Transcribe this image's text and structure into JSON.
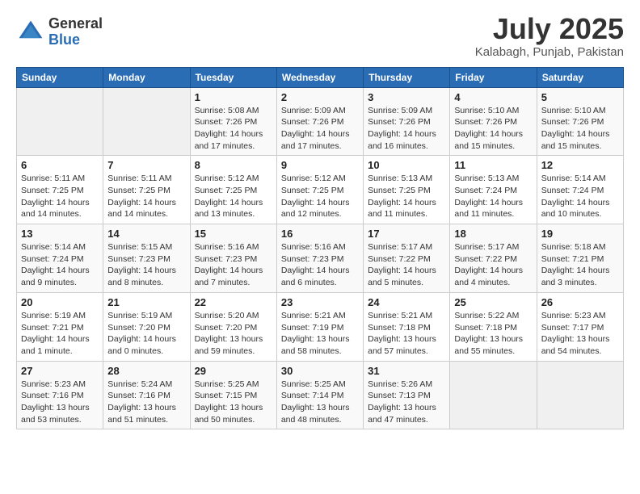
{
  "header": {
    "logo_general": "General",
    "logo_blue": "Blue",
    "month": "July 2025",
    "location": "Kalabagh, Punjab, Pakistan"
  },
  "weekdays": [
    "Sunday",
    "Monday",
    "Tuesday",
    "Wednesday",
    "Thursday",
    "Friday",
    "Saturday"
  ],
  "weeks": [
    [
      {
        "day": "",
        "info": ""
      },
      {
        "day": "",
        "info": ""
      },
      {
        "day": "1",
        "info": "Sunrise: 5:08 AM\nSunset: 7:26 PM\nDaylight: 14 hours and 17 minutes."
      },
      {
        "day": "2",
        "info": "Sunrise: 5:09 AM\nSunset: 7:26 PM\nDaylight: 14 hours and 17 minutes."
      },
      {
        "day": "3",
        "info": "Sunrise: 5:09 AM\nSunset: 7:26 PM\nDaylight: 14 hours and 16 minutes."
      },
      {
        "day": "4",
        "info": "Sunrise: 5:10 AM\nSunset: 7:26 PM\nDaylight: 14 hours and 15 minutes."
      },
      {
        "day": "5",
        "info": "Sunrise: 5:10 AM\nSunset: 7:26 PM\nDaylight: 14 hours and 15 minutes."
      }
    ],
    [
      {
        "day": "6",
        "info": "Sunrise: 5:11 AM\nSunset: 7:25 PM\nDaylight: 14 hours and 14 minutes."
      },
      {
        "day": "7",
        "info": "Sunrise: 5:11 AM\nSunset: 7:25 PM\nDaylight: 14 hours and 14 minutes."
      },
      {
        "day": "8",
        "info": "Sunrise: 5:12 AM\nSunset: 7:25 PM\nDaylight: 14 hours and 13 minutes."
      },
      {
        "day": "9",
        "info": "Sunrise: 5:12 AM\nSunset: 7:25 PM\nDaylight: 14 hours and 12 minutes."
      },
      {
        "day": "10",
        "info": "Sunrise: 5:13 AM\nSunset: 7:25 PM\nDaylight: 14 hours and 11 minutes."
      },
      {
        "day": "11",
        "info": "Sunrise: 5:13 AM\nSunset: 7:24 PM\nDaylight: 14 hours and 11 minutes."
      },
      {
        "day": "12",
        "info": "Sunrise: 5:14 AM\nSunset: 7:24 PM\nDaylight: 14 hours and 10 minutes."
      }
    ],
    [
      {
        "day": "13",
        "info": "Sunrise: 5:14 AM\nSunset: 7:24 PM\nDaylight: 14 hours and 9 minutes."
      },
      {
        "day": "14",
        "info": "Sunrise: 5:15 AM\nSunset: 7:23 PM\nDaylight: 14 hours and 8 minutes."
      },
      {
        "day": "15",
        "info": "Sunrise: 5:16 AM\nSunset: 7:23 PM\nDaylight: 14 hours and 7 minutes."
      },
      {
        "day": "16",
        "info": "Sunrise: 5:16 AM\nSunset: 7:23 PM\nDaylight: 14 hours and 6 minutes."
      },
      {
        "day": "17",
        "info": "Sunrise: 5:17 AM\nSunset: 7:22 PM\nDaylight: 14 hours and 5 minutes."
      },
      {
        "day": "18",
        "info": "Sunrise: 5:17 AM\nSunset: 7:22 PM\nDaylight: 14 hours and 4 minutes."
      },
      {
        "day": "19",
        "info": "Sunrise: 5:18 AM\nSunset: 7:21 PM\nDaylight: 14 hours and 3 minutes."
      }
    ],
    [
      {
        "day": "20",
        "info": "Sunrise: 5:19 AM\nSunset: 7:21 PM\nDaylight: 14 hours and 1 minute."
      },
      {
        "day": "21",
        "info": "Sunrise: 5:19 AM\nSunset: 7:20 PM\nDaylight: 14 hours and 0 minutes."
      },
      {
        "day": "22",
        "info": "Sunrise: 5:20 AM\nSunset: 7:20 PM\nDaylight: 13 hours and 59 minutes."
      },
      {
        "day": "23",
        "info": "Sunrise: 5:21 AM\nSunset: 7:19 PM\nDaylight: 13 hours and 58 minutes."
      },
      {
        "day": "24",
        "info": "Sunrise: 5:21 AM\nSunset: 7:18 PM\nDaylight: 13 hours and 57 minutes."
      },
      {
        "day": "25",
        "info": "Sunrise: 5:22 AM\nSunset: 7:18 PM\nDaylight: 13 hours and 55 minutes."
      },
      {
        "day": "26",
        "info": "Sunrise: 5:23 AM\nSunset: 7:17 PM\nDaylight: 13 hours and 54 minutes."
      }
    ],
    [
      {
        "day": "27",
        "info": "Sunrise: 5:23 AM\nSunset: 7:16 PM\nDaylight: 13 hours and 53 minutes."
      },
      {
        "day": "28",
        "info": "Sunrise: 5:24 AM\nSunset: 7:16 PM\nDaylight: 13 hours and 51 minutes."
      },
      {
        "day": "29",
        "info": "Sunrise: 5:25 AM\nSunset: 7:15 PM\nDaylight: 13 hours and 50 minutes."
      },
      {
        "day": "30",
        "info": "Sunrise: 5:25 AM\nSunset: 7:14 PM\nDaylight: 13 hours and 48 minutes."
      },
      {
        "day": "31",
        "info": "Sunrise: 5:26 AM\nSunset: 7:13 PM\nDaylight: 13 hours and 47 minutes."
      },
      {
        "day": "",
        "info": ""
      },
      {
        "day": "",
        "info": ""
      }
    ]
  ]
}
